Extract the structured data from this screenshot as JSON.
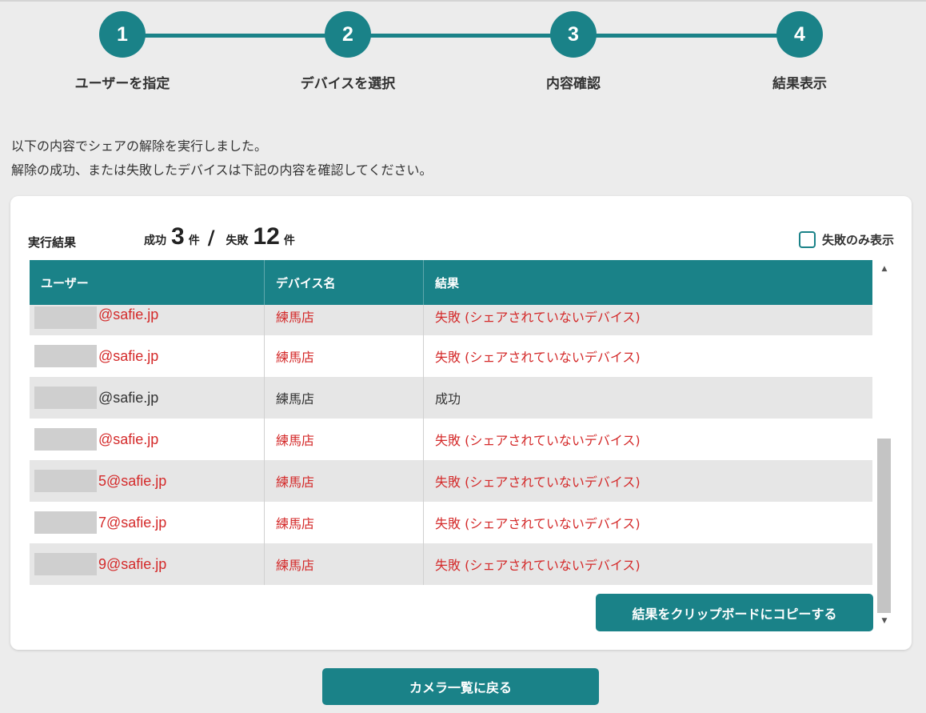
{
  "steps": [
    {
      "number": "1",
      "label": "ユーザーを指定"
    },
    {
      "number": "2",
      "label": "デバイスを選択"
    },
    {
      "number": "3",
      "label": "内容確認"
    },
    {
      "number": "4",
      "label": "結果表示"
    }
  ],
  "intro": {
    "line1": "以下の内容でシェアの解除を実行しました。",
    "line2": "解除の成功、または失敗したデバイスは下記の内容を確認してください。"
  },
  "result": {
    "label": "実行結果",
    "success_label": "成功",
    "success_count": "3",
    "unit": "件",
    "slash": "/",
    "fail_label": "失敗",
    "fail_count": "12",
    "filter_label": "失敗のみ表示",
    "filter_checked": false
  },
  "table": {
    "headers": [
      "ユーザー",
      "デバイス名",
      "結果"
    ],
    "rows": [
      {
        "user": "@safie.jp",
        "device": "練馬店",
        "result": "失敗 (シェアされていないデバイス)",
        "status": "fail"
      },
      {
        "user": "@safie.jp",
        "device": "練馬店",
        "result": "失敗 (シェアされていないデバイス)",
        "status": "fail"
      },
      {
        "user": "@safie.jp",
        "device": "練馬店",
        "result": "成功",
        "status": "ok"
      },
      {
        "user": "@safie.jp",
        "device": "練馬店",
        "result": "失敗 (シェアされていないデバイス)",
        "status": "fail"
      },
      {
        "user": "5@safie.jp",
        "device": "練馬店",
        "result": "失敗 (シェアされていないデバイス)",
        "status": "fail"
      },
      {
        "user": "7@safie.jp",
        "device": "練馬店",
        "result": "失敗 (シェアされていないデバイス)",
        "status": "fail"
      },
      {
        "user": "9@safie.jp",
        "device": "練馬店",
        "result": "失敗 (シェアされていないデバイス)",
        "status": "fail"
      }
    ]
  },
  "buttons": {
    "copy": "結果をクリップボードにコピーする",
    "back": "カメラ一覧に戻る"
  },
  "colors": {
    "accent": "#1a8288",
    "fail": "#d42a2a",
    "background": "#ececec"
  }
}
